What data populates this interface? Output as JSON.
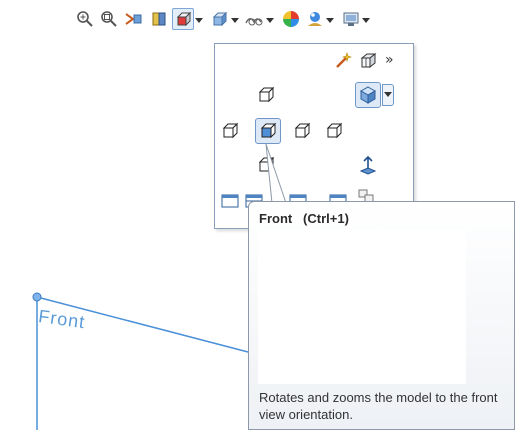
{
  "toolbar": {
    "icons": [
      "zoom-to-fit-icon",
      "zoom-to-area-icon",
      "previous-view-icon",
      "section-view-icon",
      "view-orientation-icon",
      "display-style-icon",
      "hide-show-items-icon",
      "edit-appearance-icon",
      "apply-scene-icon",
      "view-settings-icon"
    ]
  },
  "view_panel": {
    "expand_label": "»",
    "icons": [
      "view-selector-icon",
      "new-view-icon",
      "top-view-icon",
      "isometric-view-icon",
      "left-view-icon",
      "front-view-icon",
      "right-view-icon",
      "back-view-icon",
      "bottom-view-icon",
      "normal-to-icon",
      "single-view-icon",
      "two-view-horizontal-icon",
      "two-view-vertical-icon",
      "four-view-icon",
      "link-views-icon"
    ]
  },
  "tooltip": {
    "title": "Front   (Ctrl+1)",
    "description": "Rotates and zooms the model to the front view orientation."
  },
  "sketch": {
    "plane_label": "Front",
    "accent_color": "#4a90d9"
  }
}
